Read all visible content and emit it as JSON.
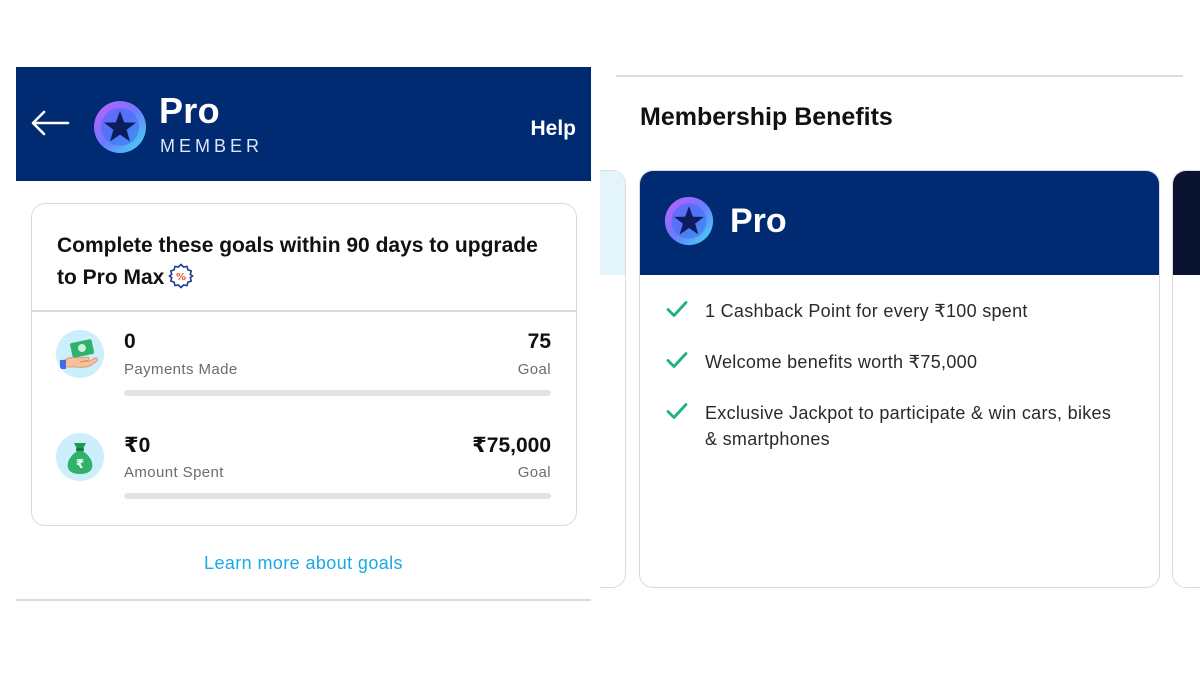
{
  "left_panel": {
    "header": {
      "back_label": "←",
      "brand_title": "Pro",
      "brand_subtitle": "MEMBER",
      "help_label": "Help",
      "bg_color": "#002a72"
    },
    "goals_card": {
      "title": "Complete these goals within 90 days to upgrade to Pro Max",
      "goals": [
        {
          "icon": "cash-payment-icon",
          "value": "0",
          "label": "Payments Made",
          "target": "75",
          "target_label": "Goal",
          "progress": 0
        },
        {
          "icon": "money-bag-icon",
          "value": "₹0",
          "label": "Amount Spent",
          "target": "₹75,000",
          "target_label": "Goal",
          "progress": 0
        }
      ]
    },
    "learn_more_label": "Learn more about goals",
    "accent_color": "#18a9e6"
  },
  "right_panel": {
    "title": "Membership Benefits",
    "card": {
      "title": "Pro",
      "benefits": [
        "1 Cashback Point for every ₹100 spent",
        "Welcome benefits worth ₹75,000",
        "Exclusive Jackpot to participate & win cars, bikes & smartphones"
      ],
      "check_color": "#1fb27a"
    }
  }
}
